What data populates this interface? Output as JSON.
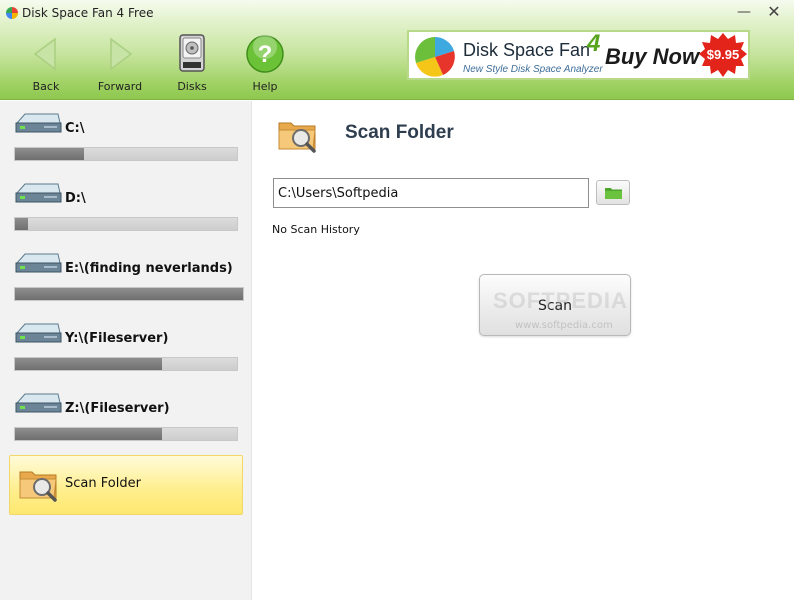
{
  "window": {
    "title": "Disk Space Fan 4 Free",
    "minimize_glyph": "—",
    "close_glyph": "✕"
  },
  "toolbar": {
    "back_label": "Back",
    "forward_label": "Forward",
    "disks_label": "Disks",
    "help_label": "Help"
  },
  "ad": {
    "title": "Disk Space Fan",
    "version": "4",
    "tagline": "New Style Disk Space Analyzer",
    "buy": "Buy Now",
    "price": "$9.95"
  },
  "sidebar": {
    "disks": [
      {
        "label": "C:\\",
        "used_fraction": 0.31
      },
      {
        "label": "D:\\",
        "used_fraction": 0.06
      },
      {
        "label": "E:\\(finding neverlands)",
        "used_fraction": 1.0
      },
      {
        "label": "Y:\\(Fileserver)",
        "used_fraction": 0.66
      },
      {
        "label": "Z:\\(Fileserver)",
        "used_fraction": 0.66
      }
    ],
    "scan_folder_label": "Scan Folder"
  },
  "main": {
    "title": "Scan Folder",
    "path_value": "C:\\Users\\Softpedia",
    "history_text": "No Scan History",
    "scan_button_label": "Scan",
    "watermark": "SOFTPEDIA",
    "watermark_url": "www.softpedia.com"
  },
  "colors": {
    "accent_green": "#8ec84f",
    "bar_fill": "#7a7a7a",
    "selected_bg": "#ffee8c"
  }
}
